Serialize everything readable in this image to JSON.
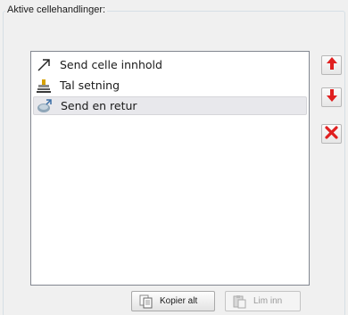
{
  "group": {
    "title": "Aktive cellehandlinger:"
  },
  "list": {
    "items": [
      {
        "label": "Send celle innhold",
        "icon": "arrow-up-right-icon",
        "selected": false
      },
      {
        "label": "Tal setning",
        "icon": "speech-icon",
        "selected": false
      },
      {
        "label": "Send en retur",
        "icon": "return-icon",
        "selected": true
      }
    ]
  },
  "side_buttons": {
    "move_up_icon": "red-arrow-up-icon",
    "move_down_icon": "red-arrow-down-icon",
    "delete_icon": "red-x-icon"
  },
  "buttons": {
    "copy_all": "Kopier alt",
    "paste": "Lim inn"
  },
  "colors": {
    "accent_red": "#e02020",
    "selection_bg": "#e8e8ec"
  }
}
